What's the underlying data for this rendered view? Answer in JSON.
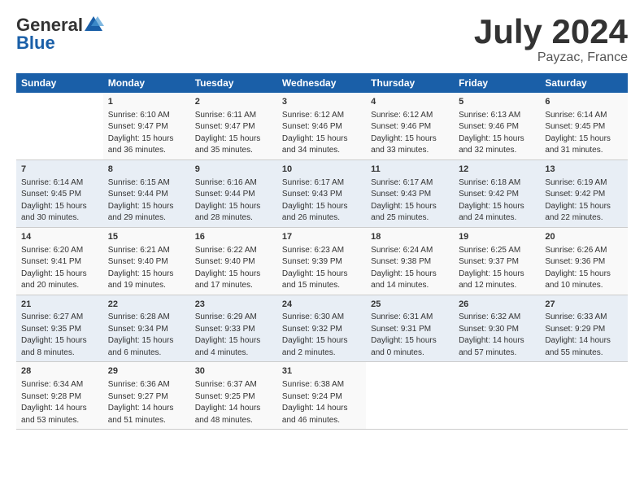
{
  "header": {
    "logo_general": "General",
    "logo_blue": "Blue",
    "month": "July 2024",
    "location": "Payzac, France"
  },
  "days_of_week": [
    "Sunday",
    "Monday",
    "Tuesday",
    "Wednesday",
    "Thursday",
    "Friday",
    "Saturday"
  ],
  "weeks": [
    [
      {
        "day": "",
        "info": ""
      },
      {
        "day": "1",
        "info": "Sunrise: 6:10 AM\nSunset: 9:47 PM\nDaylight: 15 hours\nand 36 minutes."
      },
      {
        "day": "2",
        "info": "Sunrise: 6:11 AM\nSunset: 9:47 PM\nDaylight: 15 hours\nand 35 minutes."
      },
      {
        "day": "3",
        "info": "Sunrise: 6:12 AM\nSunset: 9:46 PM\nDaylight: 15 hours\nand 34 minutes."
      },
      {
        "day": "4",
        "info": "Sunrise: 6:12 AM\nSunset: 9:46 PM\nDaylight: 15 hours\nand 33 minutes."
      },
      {
        "day": "5",
        "info": "Sunrise: 6:13 AM\nSunset: 9:46 PM\nDaylight: 15 hours\nand 32 minutes."
      },
      {
        "day": "6",
        "info": "Sunrise: 6:14 AM\nSunset: 9:45 PM\nDaylight: 15 hours\nand 31 minutes."
      }
    ],
    [
      {
        "day": "7",
        "info": "Sunrise: 6:14 AM\nSunset: 9:45 PM\nDaylight: 15 hours\nand 30 minutes."
      },
      {
        "day": "8",
        "info": "Sunrise: 6:15 AM\nSunset: 9:44 PM\nDaylight: 15 hours\nand 29 minutes."
      },
      {
        "day": "9",
        "info": "Sunrise: 6:16 AM\nSunset: 9:44 PM\nDaylight: 15 hours\nand 28 minutes."
      },
      {
        "day": "10",
        "info": "Sunrise: 6:17 AM\nSunset: 9:43 PM\nDaylight: 15 hours\nand 26 minutes."
      },
      {
        "day": "11",
        "info": "Sunrise: 6:17 AM\nSunset: 9:43 PM\nDaylight: 15 hours\nand 25 minutes."
      },
      {
        "day": "12",
        "info": "Sunrise: 6:18 AM\nSunset: 9:42 PM\nDaylight: 15 hours\nand 24 minutes."
      },
      {
        "day": "13",
        "info": "Sunrise: 6:19 AM\nSunset: 9:42 PM\nDaylight: 15 hours\nand 22 minutes."
      }
    ],
    [
      {
        "day": "14",
        "info": "Sunrise: 6:20 AM\nSunset: 9:41 PM\nDaylight: 15 hours\nand 20 minutes."
      },
      {
        "day": "15",
        "info": "Sunrise: 6:21 AM\nSunset: 9:40 PM\nDaylight: 15 hours\nand 19 minutes."
      },
      {
        "day": "16",
        "info": "Sunrise: 6:22 AM\nSunset: 9:40 PM\nDaylight: 15 hours\nand 17 minutes."
      },
      {
        "day": "17",
        "info": "Sunrise: 6:23 AM\nSunset: 9:39 PM\nDaylight: 15 hours\nand 15 minutes."
      },
      {
        "day": "18",
        "info": "Sunrise: 6:24 AM\nSunset: 9:38 PM\nDaylight: 15 hours\nand 14 minutes."
      },
      {
        "day": "19",
        "info": "Sunrise: 6:25 AM\nSunset: 9:37 PM\nDaylight: 15 hours\nand 12 minutes."
      },
      {
        "day": "20",
        "info": "Sunrise: 6:26 AM\nSunset: 9:36 PM\nDaylight: 15 hours\nand 10 minutes."
      }
    ],
    [
      {
        "day": "21",
        "info": "Sunrise: 6:27 AM\nSunset: 9:35 PM\nDaylight: 15 hours\nand 8 minutes."
      },
      {
        "day": "22",
        "info": "Sunrise: 6:28 AM\nSunset: 9:34 PM\nDaylight: 15 hours\nand 6 minutes."
      },
      {
        "day": "23",
        "info": "Sunrise: 6:29 AM\nSunset: 9:33 PM\nDaylight: 15 hours\nand 4 minutes."
      },
      {
        "day": "24",
        "info": "Sunrise: 6:30 AM\nSunset: 9:32 PM\nDaylight: 15 hours\nand 2 minutes."
      },
      {
        "day": "25",
        "info": "Sunrise: 6:31 AM\nSunset: 9:31 PM\nDaylight: 15 hours\nand 0 minutes."
      },
      {
        "day": "26",
        "info": "Sunrise: 6:32 AM\nSunset: 9:30 PM\nDaylight: 14 hours\nand 57 minutes."
      },
      {
        "day": "27",
        "info": "Sunrise: 6:33 AM\nSunset: 9:29 PM\nDaylight: 14 hours\nand 55 minutes."
      }
    ],
    [
      {
        "day": "28",
        "info": "Sunrise: 6:34 AM\nSunset: 9:28 PM\nDaylight: 14 hours\nand 53 minutes."
      },
      {
        "day": "29",
        "info": "Sunrise: 6:36 AM\nSunset: 9:27 PM\nDaylight: 14 hours\nand 51 minutes."
      },
      {
        "day": "30",
        "info": "Sunrise: 6:37 AM\nSunset: 9:25 PM\nDaylight: 14 hours\nand 48 minutes."
      },
      {
        "day": "31",
        "info": "Sunrise: 6:38 AM\nSunset: 9:24 PM\nDaylight: 14 hours\nand 46 minutes."
      },
      {
        "day": "",
        "info": ""
      },
      {
        "day": "",
        "info": ""
      },
      {
        "day": "",
        "info": ""
      }
    ]
  ]
}
